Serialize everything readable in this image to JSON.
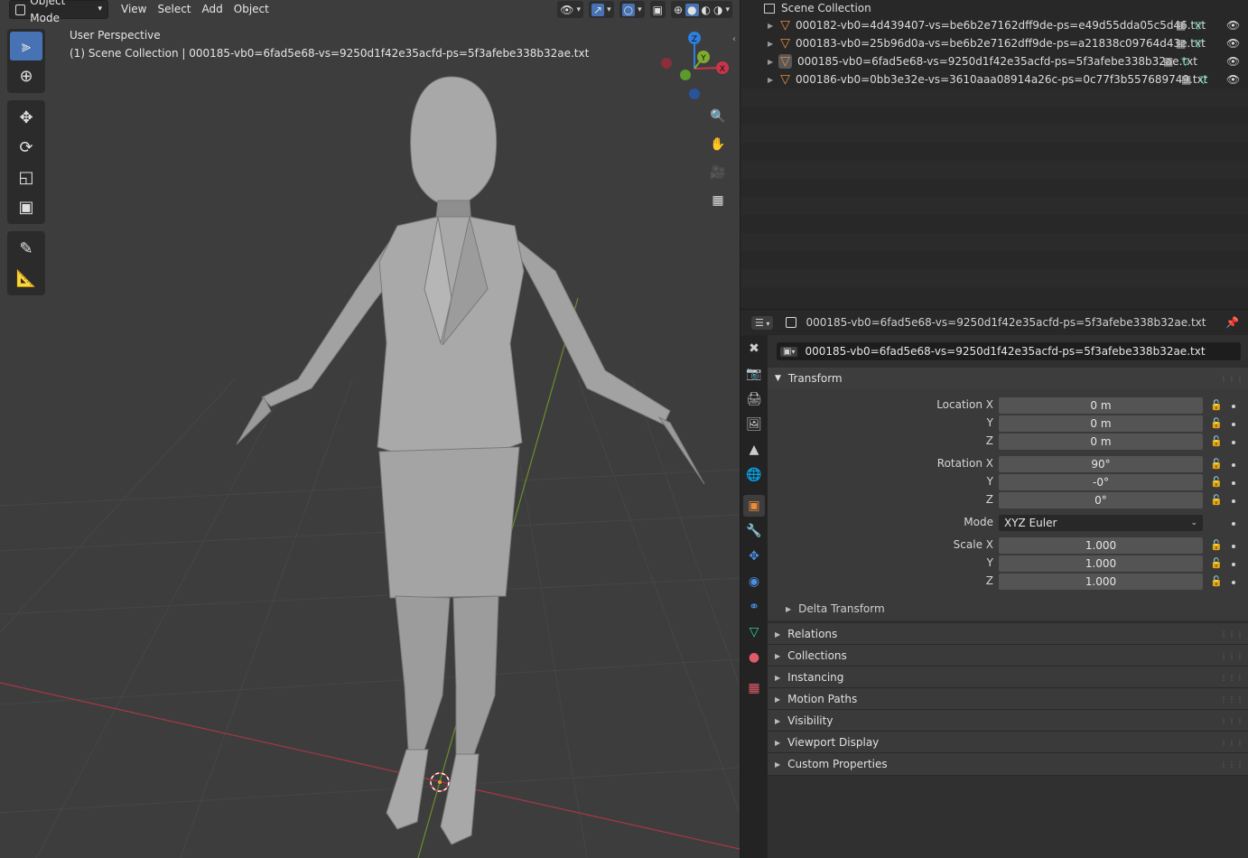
{
  "viewport": {
    "mode_label": "Object Mode",
    "menu": [
      "View",
      "Select",
      "Add",
      "Object"
    ],
    "overlay_title": "User Perspective",
    "overlay_subtitle": "(1) Scene Collection | 000185-vb0=6fad5e68-vs=9250d1f42e35acfd-ps=5f3afebe338b32ae.txt",
    "gizmo_axes": {
      "z": "Z",
      "y": "Y",
      "x": "X"
    },
    "tools": [
      "select-box",
      "cursor",
      "move",
      "rotate",
      "scale",
      "transform",
      "annotate",
      "measure"
    ],
    "nav_buttons": [
      "zoom-icon",
      "hand-icon",
      "camera-icon",
      "grid-icon"
    ]
  },
  "outliner": {
    "root": "Scene Collection",
    "items": [
      {
        "label": "000182-vb0=4d439407-vs=be6b2e7162dff9de-ps=e49d55dda05c5d46.txt",
        "selected": false
      },
      {
        "label": "000183-vb0=25b96d0a-vs=be6b2e7162dff9de-ps=a21838c09764d43e.txt",
        "selected": false
      },
      {
        "label": "000185-vb0=6fad5e68-vs=9250d1f42e35acfd-ps=5f3afebe338b32ae.txt",
        "selected": true
      },
      {
        "label": "000186-vb0=0bb3e32e-vs=3610aaa08914a26c-ps=0c77f3b557689749.txt",
        "selected": false
      }
    ]
  },
  "properties": {
    "header_object": "000185-vb0=6fad5e68-vs=9250d1f42e35acfd-ps=5f3afebe338b32ae.txt",
    "object_name": "000185-vb0=6fad5e68-vs=9250d1f42e35acfd-ps=5f3afebe338b32ae.txt",
    "transform": {
      "title": "Transform",
      "location_label": "Location X",
      "location": [
        "0 m",
        "0 m",
        "0 m"
      ],
      "rotation_label": "Rotation X",
      "rotation": [
        "90°",
        "-0°",
        "0°"
      ],
      "mode_label": "Mode",
      "mode_value": "XYZ Euler",
      "scale_label": "Scale X",
      "scale": [
        "1.000",
        "1.000",
        "1.000"
      ],
      "y_label": "Y",
      "z_label": "Z",
      "delta": "Delta Transform"
    },
    "panels": [
      "Relations",
      "Collections",
      "Instancing",
      "Motion Paths",
      "Visibility",
      "Viewport Display",
      "Custom Properties"
    ]
  },
  "colors": {
    "accent": "#4772b3",
    "x_axis": "#c8354a",
    "y_axis": "#7fab2e",
    "z_axis": "#2e7fe0",
    "mesh_orange": "#e98b3a",
    "mesh_green": "#2fcf8a"
  }
}
